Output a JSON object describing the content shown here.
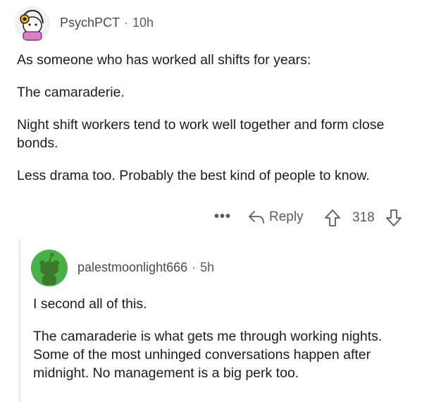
{
  "top_comment": {
    "username": "PsychPCT",
    "time": "10h",
    "paragraphs": [
      "As someone who has worked all shifts for years:",
      "The camaraderie.",
      "Night shift workers tend to work well together and form close bonds.",
      "Less drama too. Probably the best kind of people to know."
    ],
    "actions": {
      "more": "•••",
      "reply_label": "Reply",
      "score": "318"
    },
    "avatar_icon": "snoo-avatar-headphones"
  },
  "reply_comment": {
    "username": "palestmoonlight666",
    "time": "5h",
    "paragraphs": [
      "I second all of this.",
      "The camaraderie is what gets me through working nights. Some of the most unhinged conversations happen after midnight. No management is a big perk too."
    ],
    "avatar_icon": "snoo-avatar-green"
  },
  "separator": "·",
  "colors": {
    "text": "#1c1c1c",
    "meta": "#5b5b5b",
    "reply_avatar": "#46b246"
  }
}
